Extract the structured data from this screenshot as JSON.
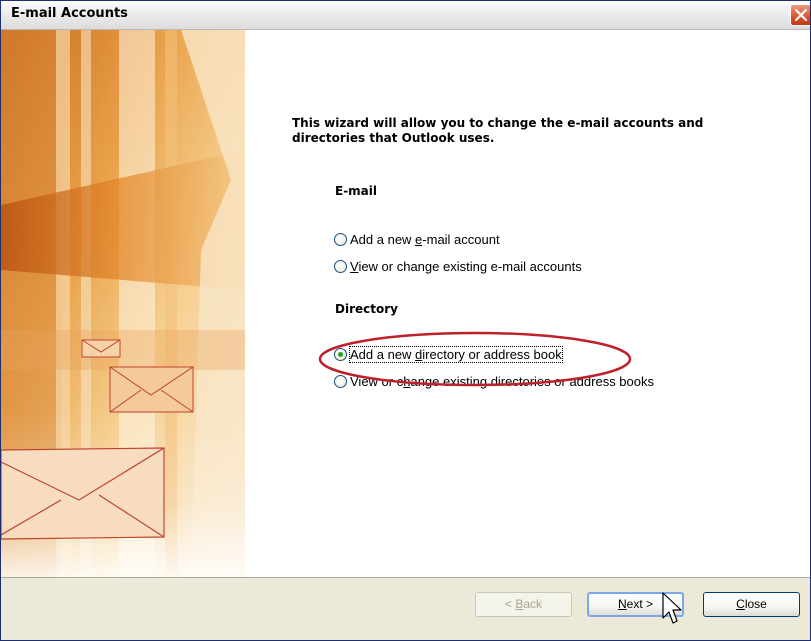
{
  "window": {
    "title": "E-mail Accounts"
  },
  "wizard": {
    "intro": "This wizard will allow you to change the e-mail accounts and directories that Outlook uses.",
    "email": {
      "heading": "E-mail",
      "options": [
        {
          "pre": "Add a new ",
          "accel": "e",
          "post": "-mail account",
          "selected": false
        },
        {
          "pre": "",
          "accel": "V",
          "post": "iew or change existing e-mail accounts",
          "selected": false
        }
      ]
    },
    "directory": {
      "heading": "Directory",
      "options": [
        {
          "pre": "Add a new ",
          "accel": "d",
          "post": "irectory or address book",
          "selected": true
        },
        {
          "pre": "View or c",
          "accel": "h",
          "post": "ange existing directories or address books",
          "selected": false
        }
      ]
    }
  },
  "buttons": {
    "back": {
      "pre": "< ",
      "accel": "B",
      "post": "ack",
      "enabled": false
    },
    "next": {
      "pre": "",
      "accel": "N",
      "post": "ext >",
      "enabled": true
    },
    "close": {
      "pre": "",
      "accel": "C",
      "post": "lose",
      "enabled": true
    }
  },
  "colors": {
    "highlight_ring": "#c0202a",
    "radio_selected": "#21a121",
    "title_bar": "#e6e6e6",
    "close_button": "#d9512b"
  },
  "icons": [
    "close-icon",
    "envelope-icon",
    "mouse-cursor-icon"
  ]
}
